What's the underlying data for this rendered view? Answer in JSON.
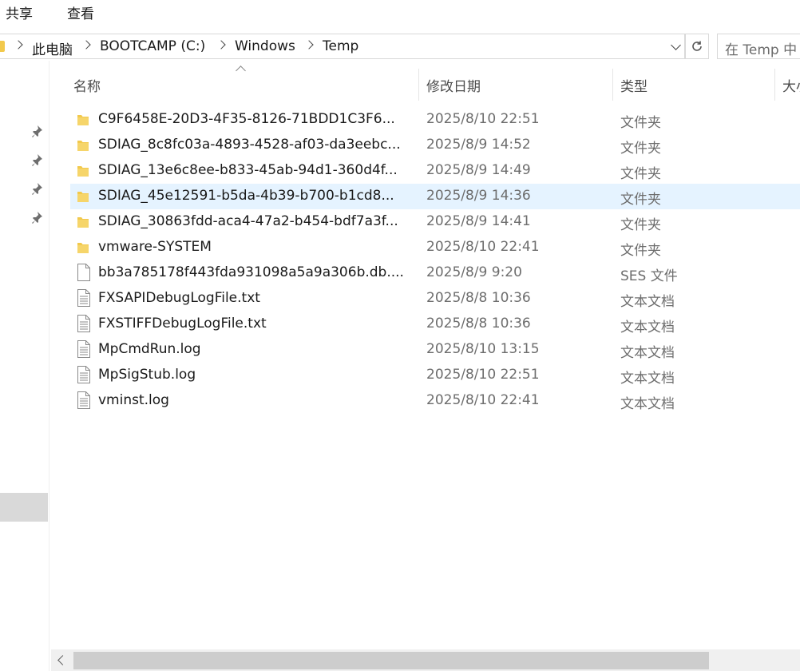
{
  "ribbon": {
    "tab_share": "共享",
    "tab_view": "查看"
  },
  "address": {
    "crumbs": [
      "此电脑",
      "BOOTCAMP (C:)",
      "Windows",
      "Temp"
    ]
  },
  "search": {
    "placeholder": "在 Temp 中"
  },
  "columns": {
    "name": "名称",
    "date": "修改日期",
    "type": "类型",
    "size": "大小"
  },
  "files": [
    {
      "name": "C9F6458E-20D3-4F35-8126-71BDD1C3F6...",
      "date": "2025/8/10 22:51",
      "type": "文件夹",
      "kind": "folder"
    },
    {
      "name": "SDIAG_8c8fc03a-4893-4528-af03-da3eebc...",
      "date": "2025/8/9 14:52",
      "type": "文件夹",
      "kind": "folder"
    },
    {
      "name": "SDIAG_13e6c8ee-b833-45ab-94d1-360d4f...",
      "date": "2025/8/9 14:49",
      "type": "文件夹",
      "kind": "folder"
    },
    {
      "name": "SDIAG_45e12591-b5da-4b39-b700-b1cd8...",
      "date": "2025/8/9 14:36",
      "type": "文件夹",
      "kind": "folder",
      "selected": true
    },
    {
      "name": "SDIAG_30863fdd-aca4-47a2-b454-bdf7a3f...",
      "date": "2025/8/9 14:41",
      "type": "文件夹",
      "kind": "folder"
    },
    {
      "name": "vmware-SYSTEM",
      "date": "2025/8/10 22:41",
      "type": "文件夹",
      "kind": "folder"
    },
    {
      "name": "bb3a785178f443fda931098a5a9a306b.db....",
      "date": "2025/8/9 9:20",
      "type": "SES 文件",
      "kind": "file"
    },
    {
      "name": "FXSAPIDebugLogFile.txt",
      "date": "2025/8/8 10:36",
      "type": "文本文档",
      "kind": "text"
    },
    {
      "name": "FXSTIFFDebugLogFile.txt",
      "date": "2025/8/8 10:36",
      "type": "文本文档",
      "kind": "text"
    },
    {
      "name": "MpCmdRun.log",
      "date": "2025/8/10 13:15",
      "type": "文本文档",
      "kind": "text"
    },
    {
      "name": "MpSigStub.log",
      "date": "2025/8/10 22:51",
      "type": "文本文档",
      "kind": "text"
    },
    {
      "name": "vminst.log",
      "date": "2025/8/10 22:41",
      "type": "文本文档",
      "kind": "text"
    }
  ],
  "icons": {
    "folder": "folder-icon",
    "file": "blank-file-icon",
    "text": "text-document-icon",
    "pin": "pin-icon",
    "refresh": "refresh-icon"
  },
  "colors": {
    "selected_row": "#e5f3ff",
    "folder": "#f2c94c"
  }
}
